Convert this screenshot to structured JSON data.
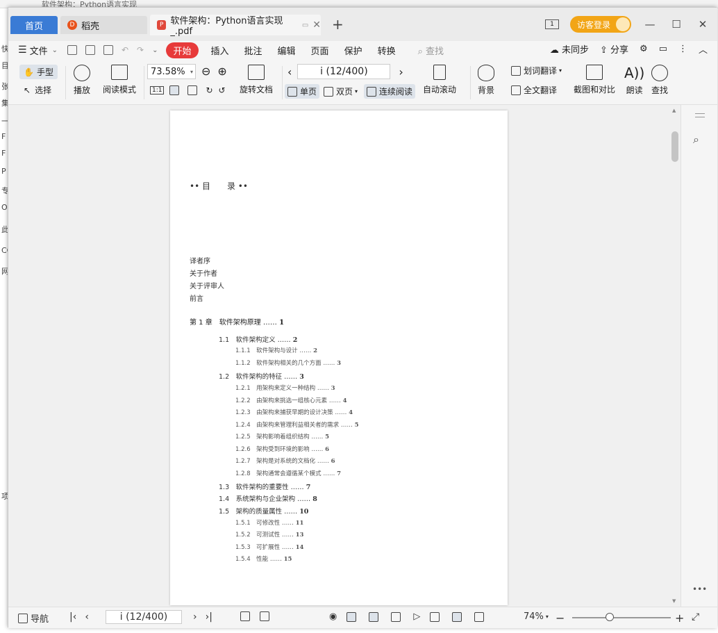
{
  "background": {
    "title": "软件架构：Python语言实现",
    "side_chars": [
      "快",
      "目",
      "张",
      "集",
      "一",
      "F",
      "F",
      "P",
      "专",
      "On",
      "此",
      "CC",
      "网",
      "项"
    ]
  },
  "tabs": [
    {
      "label": "首页"
    },
    {
      "label": "稻壳"
    },
    {
      "label": "软件架构：Python语言实现_.pdf"
    }
  ],
  "titlebar": {
    "visitor_label": "访客登录",
    "page_ico": "1"
  },
  "menu": {
    "file": "文件",
    "items": [
      "开始",
      "插入",
      "批注",
      "编辑",
      "页面",
      "保护",
      "转换"
    ],
    "search": "查找",
    "unsynced": "未同步",
    "share": "分享"
  },
  "ribbon": {
    "hand": "手型",
    "select": "选择",
    "play": "播放",
    "read_mode": "阅读模式",
    "zoom": "73.58%",
    "actual_size": "1:1",
    "rotate": "旋转文档",
    "page_indicator": "i (12/400)",
    "single": "单页",
    "double": "双页",
    "continuous": "连续阅读",
    "auto_scroll": "自动滚动",
    "background": "背景",
    "word_translate": "划词翻译",
    "full_translate": "全文翻译",
    "screenshot_compare": "截图和对比",
    "read_aloud": "朗读",
    "find": "查找"
  },
  "document": {
    "toc_title": "•• 目　　录 ••",
    "front_matter": [
      "译者序",
      "关于作者",
      "关于评审人",
      "前言"
    ],
    "chapter": {
      "label": "第 1 章　软件架构原理 ……",
      "page": "1"
    },
    "entries": [
      {
        "num": "1.1",
        "title": "软件架构定义 ……",
        "page": "2",
        "level": 1
      },
      {
        "num": "1.1.1",
        "title": "软件架构与设计 ……",
        "page": "2",
        "level": 2
      },
      {
        "num": "1.1.2",
        "title": "软件架构相关的几个方面 ……",
        "page": "3",
        "level": 2
      },
      {
        "num": "1.2",
        "title": "软件架构的特征 ……",
        "page": "3",
        "level": 1
      },
      {
        "num": "1.2.1",
        "title": "用架构来定义一种结构 ……",
        "page": "3",
        "level": 2
      },
      {
        "num": "1.2.2",
        "title": "由架构来挑选一组核心元素 ……",
        "page": "4",
        "level": 2
      },
      {
        "num": "1.2.3",
        "title": "由架构来捕获早期的设计决策 ……",
        "page": "4",
        "level": 2
      },
      {
        "num": "1.2.4",
        "title": "由架构来管理利益相关者的需求 ……",
        "page": "5",
        "level": 2
      },
      {
        "num": "1.2.5",
        "title": "架构影响着组织结构 ……",
        "page": "5",
        "level": 2
      },
      {
        "num": "1.2.6",
        "title": "架构受到环境的影响 ……",
        "page": "6",
        "level": 2
      },
      {
        "num": "1.2.7",
        "title": "架构是对系统的文档化 ……",
        "page": "6",
        "level": 2
      },
      {
        "num": "1.2.8",
        "title": "架构通常会遵循某个模式 ……",
        "page": "7",
        "level": 2
      },
      {
        "num": "1.3",
        "title": "软件架构的重要性 ……",
        "page": "7",
        "level": 1
      },
      {
        "num": "1.4",
        "title": "系统架构与企业架构 ……",
        "page": "8",
        "level": 1
      },
      {
        "num": "1.5",
        "title": "架构的质量属性 ……",
        "page": "10",
        "level": 1
      },
      {
        "num": "1.5.1",
        "title": "可修改性 ……",
        "page": "11",
        "level": 2
      },
      {
        "num": "1.5.2",
        "title": "可测试性 ……",
        "page": "13",
        "level": 2
      },
      {
        "num": "1.5.3",
        "title": "可扩展性 ……",
        "page": "14",
        "level": 2
      },
      {
        "num": "1.5.4",
        "title": "性能 ……",
        "page": "15",
        "level": 2
      }
    ]
  },
  "statusbar": {
    "nav": "导航",
    "page_indicator": "i (12/400)",
    "zoom": "74%"
  }
}
